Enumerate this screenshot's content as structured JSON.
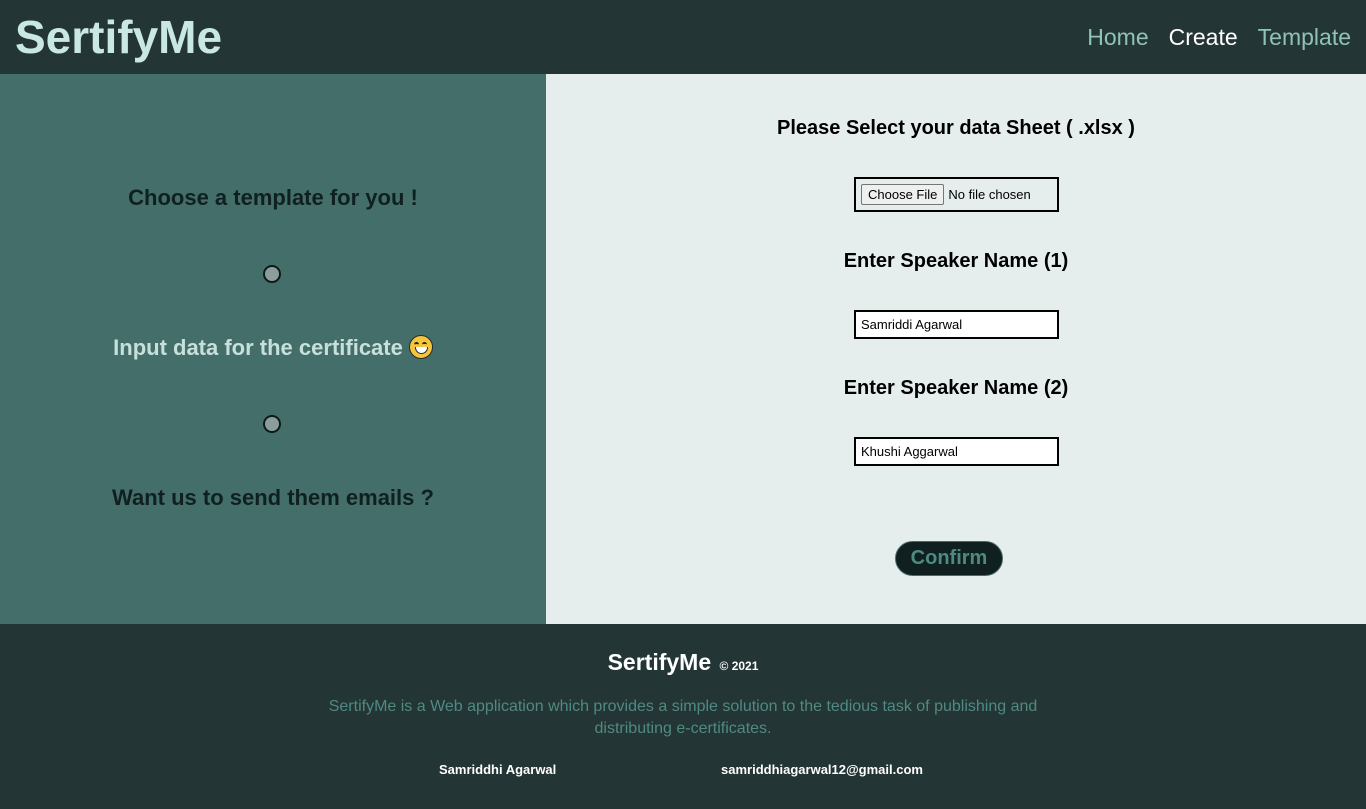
{
  "header": {
    "brand": "SertifyMe",
    "nav": [
      "Home",
      "Create",
      "Template"
    ],
    "active_nav": "Create"
  },
  "steps": {
    "step1": "Choose a template for you !",
    "step2": "Input data for the certificate",
    "step3": "Want us to send them emails ?"
  },
  "form": {
    "sheet_label": "Please Select your data Sheet ( .xlsx )",
    "file_button": "Choose File",
    "file_status": "No file chosen",
    "speaker1_label": "Enter Speaker Name (1)",
    "speaker1_value": "Samriddi Agarwal",
    "speaker2_label": "Enter Speaker Name (2)",
    "speaker2_value": "Khushi Aggarwal",
    "confirm_label": "Confirm"
  },
  "footer": {
    "title": "SertifyMe",
    "copyright": "© 2021",
    "description": "SertifyMe is a Web application which provides a simple solution to the tedious task of publishing and distributing e-certificates.",
    "author": "Samriddhi Agarwal",
    "email": "samriddhiagarwal12@gmail.com"
  },
  "colors": {
    "dark": "#243535",
    "left_panel": "#436e69",
    "right_panel": "#e5eeed",
    "accent": "#8fc3b8"
  },
  "icons": {
    "emoji": "grinning-face-icon",
    "step_markers": "radio-circle-icon"
  }
}
